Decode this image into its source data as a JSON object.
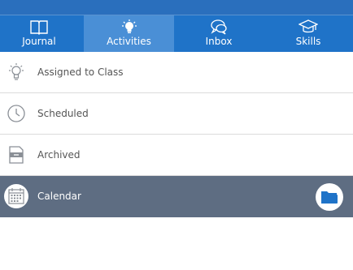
{
  "tabs": [
    {
      "label": "Journal",
      "icon": "book-icon",
      "active": false
    },
    {
      "label": "Activities",
      "icon": "lightbulb-icon",
      "active": true
    },
    {
      "label": "Inbox",
      "icon": "chat-bubbles-icon",
      "active": false
    },
    {
      "label": "Skills",
      "icon": "graduation-cap-icon",
      "active": false
    }
  ],
  "list": {
    "items": [
      {
        "label": "Assigned to Class",
        "icon": "lightbulb-icon"
      },
      {
        "label": "Scheduled",
        "icon": "clock-icon"
      },
      {
        "label": "Archived",
        "icon": "archive-box-icon"
      },
      {
        "label": "Calendar",
        "icon": "calendar-icon",
        "selected": true
      }
    ]
  },
  "colors": {
    "topbar": "#2a6fbd",
    "tabbar": "#1f73c8",
    "tab_active": "#4a8fd6",
    "selected_row": "#5e6d82",
    "folder_icon": "#1f73c8"
  }
}
